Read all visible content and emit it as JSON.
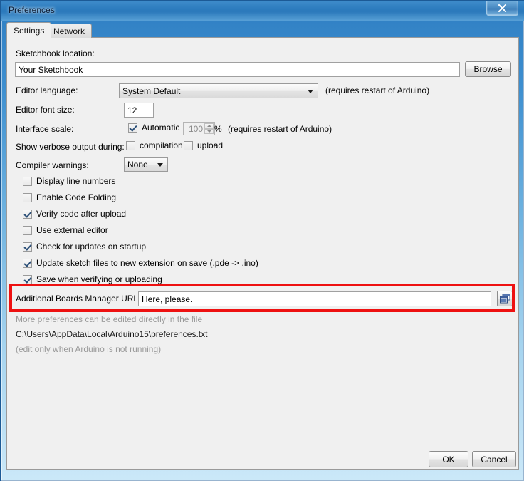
{
  "window": {
    "title": "Preferences",
    "close_label": "×"
  },
  "tabs": [
    {
      "label": "Settings",
      "active": true
    },
    {
      "label": "Network",
      "active": false
    }
  ],
  "form": {
    "sketchbook_label": "Sketchbook location:",
    "sketchbook_value": "Your Sketchbook",
    "browse_label": "Browse",
    "editor_language_label": "Editor language:",
    "editor_language_value": "System Default",
    "editor_language_note": "(requires restart of Arduino)",
    "editor_font_size_label": "Editor font size:",
    "editor_font_size_value": "12",
    "interface_scale_label": "Interface scale:",
    "interface_scale_automatic_label": "Automatic",
    "interface_scale_value": "100",
    "interface_scale_percent": "%",
    "interface_scale_note": "(requires restart of Arduino)",
    "verbose_label": "Show verbose output during:",
    "verbose_compilation_label": "compilation",
    "verbose_upload_label": "upload",
    "compiler_warnings_label": "Compiler warnings:",
    "compiler_warnings_value": "None"
  },
  "checkboxes": [
    {
      "label": "Display line numbers",
      "checked": false
    },
    {
      "label": "Enable Code Folding",
      "checked": false
    },
    {
      "label": "Verify code after upload",
      "checked": true
    },
    {
      "label": "Use external editor",
      "checked": false
    },
    {
      "label": "Check for updates on startup",
      "checked": true
    },
    {
      "label": "Update sketch files to new extension on save (.pde -> .ino)",
      "checked": true
    },
    {
      "label": "Save when verifying or uploading",
      "checked": true
    }
  ],
  "boards_urls": {
    "label": "Additional Boards Manager URLs:",
    "value": "Here, please.",
    "expand_icon": "window-expand-icon"
  },
  "notes": {
    "line1": "More preferences can be edited directly in the file",
    "line2": "C:\\Users\\AppData\\Local\\Arduino15\\preferences.txt",
    "line3": "(edit only when Arduino is not running)"
  },
  "footer": {
    "ok_label": "OK",
    "cancel_label": "Cancel"
  },
  "colors": {
    "highlight_red": "#ee1111",
    "titlebar_blue": "#2d7cbe",
    "panel_bg": "#f0f0f0"
  }
}
